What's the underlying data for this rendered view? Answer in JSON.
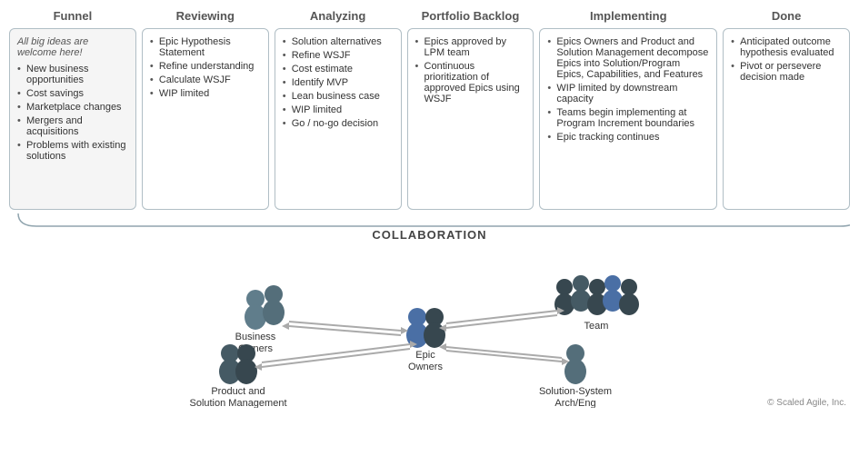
{
  "columns": [
    {
      "id": "funnel",
      "title": "Funnel",
      "italic": "All big ideas are welcome here!",
      "items": [
        "New business opportunities",
        "Cost savings",
        "Marketplace changes",
        "Mergers and acquisitions",
        "Problems with existing solutions"
      ]
    },
    {
      "id": "reviewing",
      "title": "Reviewing",
      "items": [
        "Epic Hypothesis Statement",
        "Refine understanding",
        "Calculate WSJF",
        "WIP limited"
      ]
    },
    {
      "id": "analyzing",
      "title": "Analyzing",
      "items": [
        "Solution alternatives",
        "Refine WSJF",
        "Cost estimate",
        "Identify MVP",
        "Lean business case",
        "WIP limited",
        "Go / no-go decision"
      ]
    },
    {
      "id": "portfolio-backlog",
      "title": "Portfolio Backlog",
      "items": [
        "Epics approved by LPM team",
        "Continuous prioritization of approved Epics using WSJF"
      ]
    },
    {
      "id": "implementing",
      "title": "Implementing",
      "items": [
        "Epics Owners and Product and Solution Management decompose Epics into Solution/Program Epics, Capabilities, and Features",
        "WIP limited by downstream capacity",
        "Teams begin implementing at Program Increment boundaries",
        "Epic tracking continues"
      ]
    },
    {
      "id": "done",
      "title": "Done",
      "items": [
        "Anticipated outcome hypothesis evaluated",
        "Pivot or persevere decision made"
      ]
    }
  ],
  "collaboration": {
    "title": "COLLABORATION",
    "groups": [
      {
        "id": "business-owners",
        "label": "Business\nOwners",
        "position": "top-left",
        "type": "duo-female"
      },
      {
        "id": "team",
        "label": "Team",
        "position": "top-right",
        "type": "multi"
      },
      {
        "id": "epic-owners",
        "label": "Epic\nOwners",
        "position": "center",
        "type": "duo-mixed"
      },
      {
        "id": "product-solution",
        "label": "Product and\nSolution Management",
        "position": "bottom-left",
        "type": "duo-suit"
      },
      {
        "id": "solution-system",
        "label": "Solution-System\nArch/Eng",
        "position": "bottom-right",
        "type": "solo-female"
      }
    ]
  },
  "copyright": "© Scaled Agile, Inc."
}
